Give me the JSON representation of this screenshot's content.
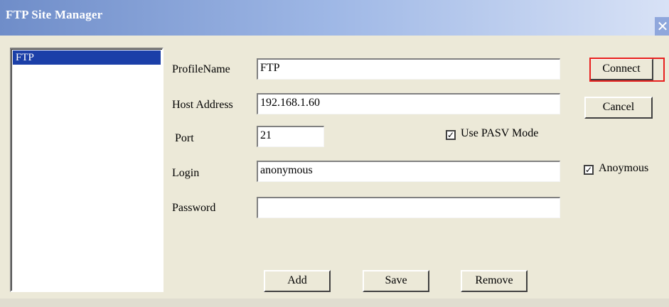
{
  "window": {
    "title": "FTP Site Manager",
    "close_glyph": "✕"
  },
  "site_list": {
    "items": [
      "FTP"
    ],
    "selected": "FTP"
  },
  "form": {
    "profile_name": {
      "label": "ProfileName",
      "value": "FTP"
    },
    "host_address": {
      "label": "Host Address",
      "value": "192.168.1.60"
    },
    "port": {
      "label": "Port",
      "value": "21"
    },
    "use_pasv": {
      "label": "Use PASV Mode",
      "checked": true
    },
    "login": {
      "label": "Login",
      "value": "anonymous"
    },
    "anonymous": {
      "label": "Anoymous",
      "checked": true
    },
    "password": {
      "label": "Password",
      "value": ""
    }
  },
  "buttons": {
    "connect": "Connect",
    "cancel": "Cancel",
    "add": "Add",
    "save": "Save",
    "remove": "Remove"
  },
  "colors": {
    "highlight_box": "#e8201e",
    "selection": "#1b3fa8"
  }
}
